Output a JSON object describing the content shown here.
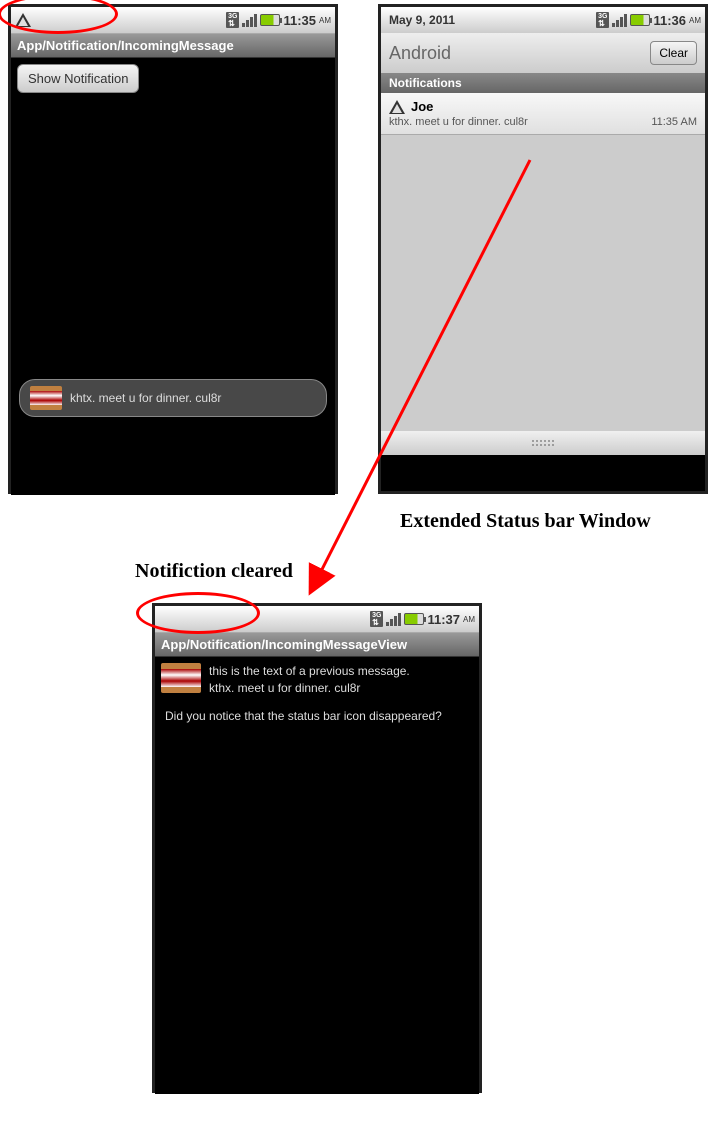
{
  "screen1": {
    "time": "11:35",
    "ampm": "AM",
    "title": "App/Notification/IncomingMessage",
    "button_label": "Show Notification",
    "toast_text": "khtx. meet u for dinner. cul8r"
  },
  "screen2": {
    "date": "May 9, 2011",
    "time": "11:36",
    "ampm": "AM",
    "header_title": "Android",
    "clear_label": "Clear",
    "section_label": "Notifications",
    "notification": {
      "sender": "Joe",
      "text": "kthx. meet u for dinner. cul8r",
      "time": "11:35 AM"
    }
  },
  "screen3": {
    "time": "11:37",
    "ampm": "AM",
    "title": "App/Notification/IncomingMessageView",
    "line1": "this is the text of a previous message.",
    "line2": "kthx. meet u for dinner. cul8r",
    "question": "Did you notice that the status bar icon disappeared?"
  },
  "captions": {
    "right": "Extended Status bar Window",
    "left": "Notifiction cleared"
  }
}
